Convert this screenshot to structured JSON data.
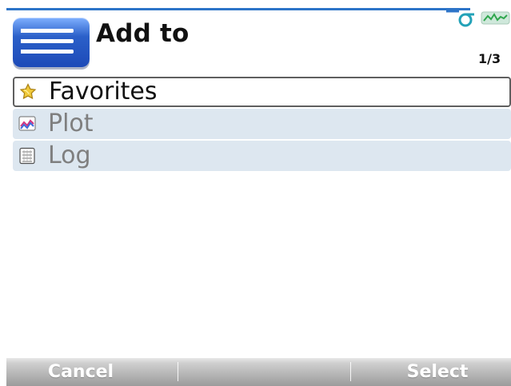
{
  "header": {
    "title": "Add to",
    "page_counter": "1/3"
  },
  "list": {
    "items": [
      {
        "label": "Favorites",
        "icon": "favorites-icon",
        "state": "selected"
      },
      {
        "label": "Plot",
        "icon": "plot-icon",
        "state": "normal"
      },
      {
        "label": "Log",
        "icon": "log-icon",
        "state": "normal"
      }
    ]
  },
  "softkeys": {
    "left": "Cancel",
    "right": "Select"
  },
  "colors": {
    "accent": "#2d74c8",
    "list_background": "#dde7f0",
    "softkey_bar": "#9b9b9b"
  }
}
